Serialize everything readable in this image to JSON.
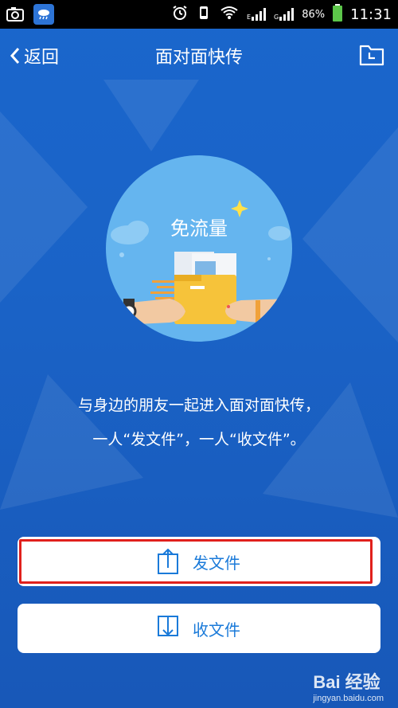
{
  "status_bar": {
    "network_e": "E",
    "network_g": "G",
    "battery": "86%",
    "time": "11:31"
  },
  "nav": {
    "back_label": "返回",
    "title": "面对面快传"
  },
  "hero": {
    "caption": "免流量"
  },
  "description": {
    "line1": "与身边的朋友一起进入面对面快传，",
    "line2": "一人“发文件”，一人“收文件”。"
  },
  "actions": {
    "send_label": "发文件",
    "receive_label": "收文件"
  },
  "watermark": {
    "brand": "Bai 经验",
    "url": "jingyan.baidu.com"
  },
  "colors": {
    "background": "#1a66cc",
    "accent": "#1a7ad9",
    "highlight_border": "#e0201c"
  }
}
